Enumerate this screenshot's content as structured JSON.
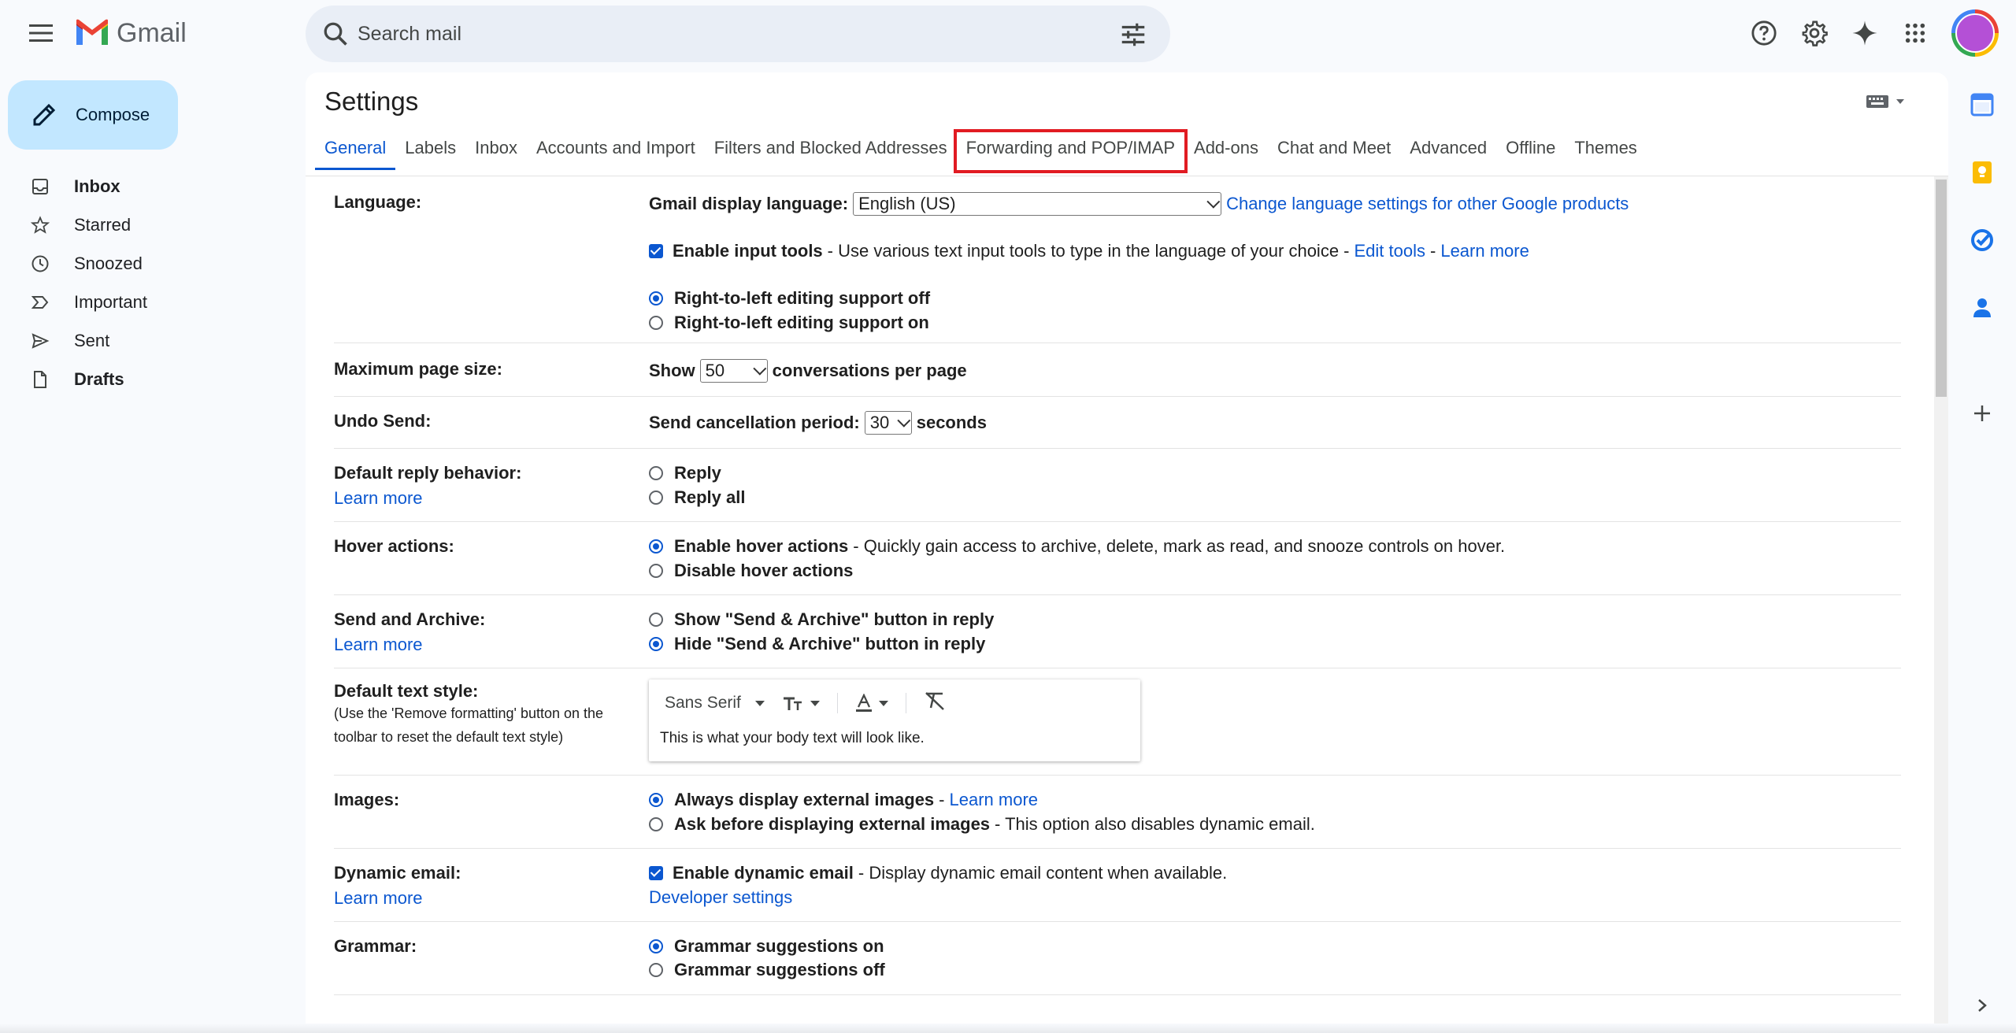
{
  "header": {
    "logo_text": "Gmail",
    "search_placeholder": "Search mail"
  },
  "compose_label": "Compose",
  "nav": [
    {
      "label": "Inbox",
      "icon": "inbox-icon",
      "bold": true
    },
    {
      "label": "Starred",
      "icon": "star-icon",
      "bold": false
    },
    {
      "label": "Snoozed",
      "icon": "clock-icon",
      "bold": false
    },
    {
      "label": "Important",
      "icon": "important-icon",
      "bold": false
    },
    {
      "label": "Sent",
      "icon": "send-icon",
      "bold": false
    },
    {
      "label": "Drafts",
      "icon": "draft-icon",
      "bold": true
    }
  ],
  "settings_title": "Settings",
  "tabs": [
    {
      "label": "General",
      "active": true
    },
    {
      "label": "Labels"
    },
    {
      "label": "Inbox"
    },
    {
      "label": "Accounts and Import"
    },
    {
      "label": "Filters and Blocked Addresses"
    },
    {
      "label": "Forwarding and POP/IMAP",
      "highlighted": true
    },
    {
      "label": "Add-ons"
    },
    {
      "label": "Chat and Meet"
    },
    {
      "label": "Advanced"
    },
    {
      "label": "Offline"
    },
    {
      "label": "Themes"
    }
  ],
  "language": {
    "label": "Language:",
    "display_label": "Gmail display language:",
    "display_value": "English (US)",
    "change_link": "Change language settings for other Google products",
    "input_tools_label": "Enable input tools",
    "input_tools_desc": "- Use various text input tools to type in the language of your choice -",
    "edit_tools": "Edit tools",
    "dash": "-",
    "learn_more": "Learn more",
    "rtl_off": "Right-to-left editing support off",
    "rtl_on": "Right-to-left editing support on"
  },
  "page_size": {
    "label": "Maximum page size:",
    "show": "Show",
    "value": "50",
    "suffix": "conversations per page"
  },
  "undo_send": {
    "label": "Undo Send:",
    "prefix": "Send cancellation period:",
    "value": "30",
    "suffix": "seconds"
  },
  "reply": {
    "label": "Default reply behavior:",
    "learn_more": "Learn more",
    "opt1": "Reply",
    "opt2": "Reply all"
  },
  "hover": {
    "label": "Hover actions:",
    "opt1": "Enable hover actions",
    "opt1_desc": "- Quickly gain access to archive, delete, mark as read, and snooze controls on hover.",
    "opt2": "Disable hover actions"
  },
  "send_archive": {
    "label": "Send and Archive:",
    "learn_more": "Learn more",
    "opt1": "Show \"Send & Archive\" button in reply",
    "opt2": "Hide \"Send & Archive\" button in reply"
  },
  "text_style": {
    "label": "Default text style:",
    "sub": "(Use the 'Remove formatting' button on the toolbar to reset the default text style)",
    "font": "Sans Serif",
    "preview": "This is what your body text will look like."
  },
  "images": {
    "label": "Images:",
    "opt1": "Always display external images",
    "opt1_sep": "-",
    "learn_more": "Learn more",
    "opt2": "Ask before displaying external images",
    "opt2_desc": "- This option also disables dynamic email."
  },
  "dynamic": {
    "label": "Dynamic email:",
    "learn_more": "Learn more",
    "opt1": "Enable dynamic email",
    "opt1_desc": "- Display dynamic email content when available.",
    "dev_settings": "Developer settings"
  },
  "grammar": {
    "label": "Grammar:",
    "opt1": "Grammar suggestions on",
    "opt2": "Grammar suggestions off"
  },
  "colors": {
    "accent": "#0b57d0",
    "compose_bg": "#c2e7ff",
    "highlight_box": "#e11b22"
  }
}
